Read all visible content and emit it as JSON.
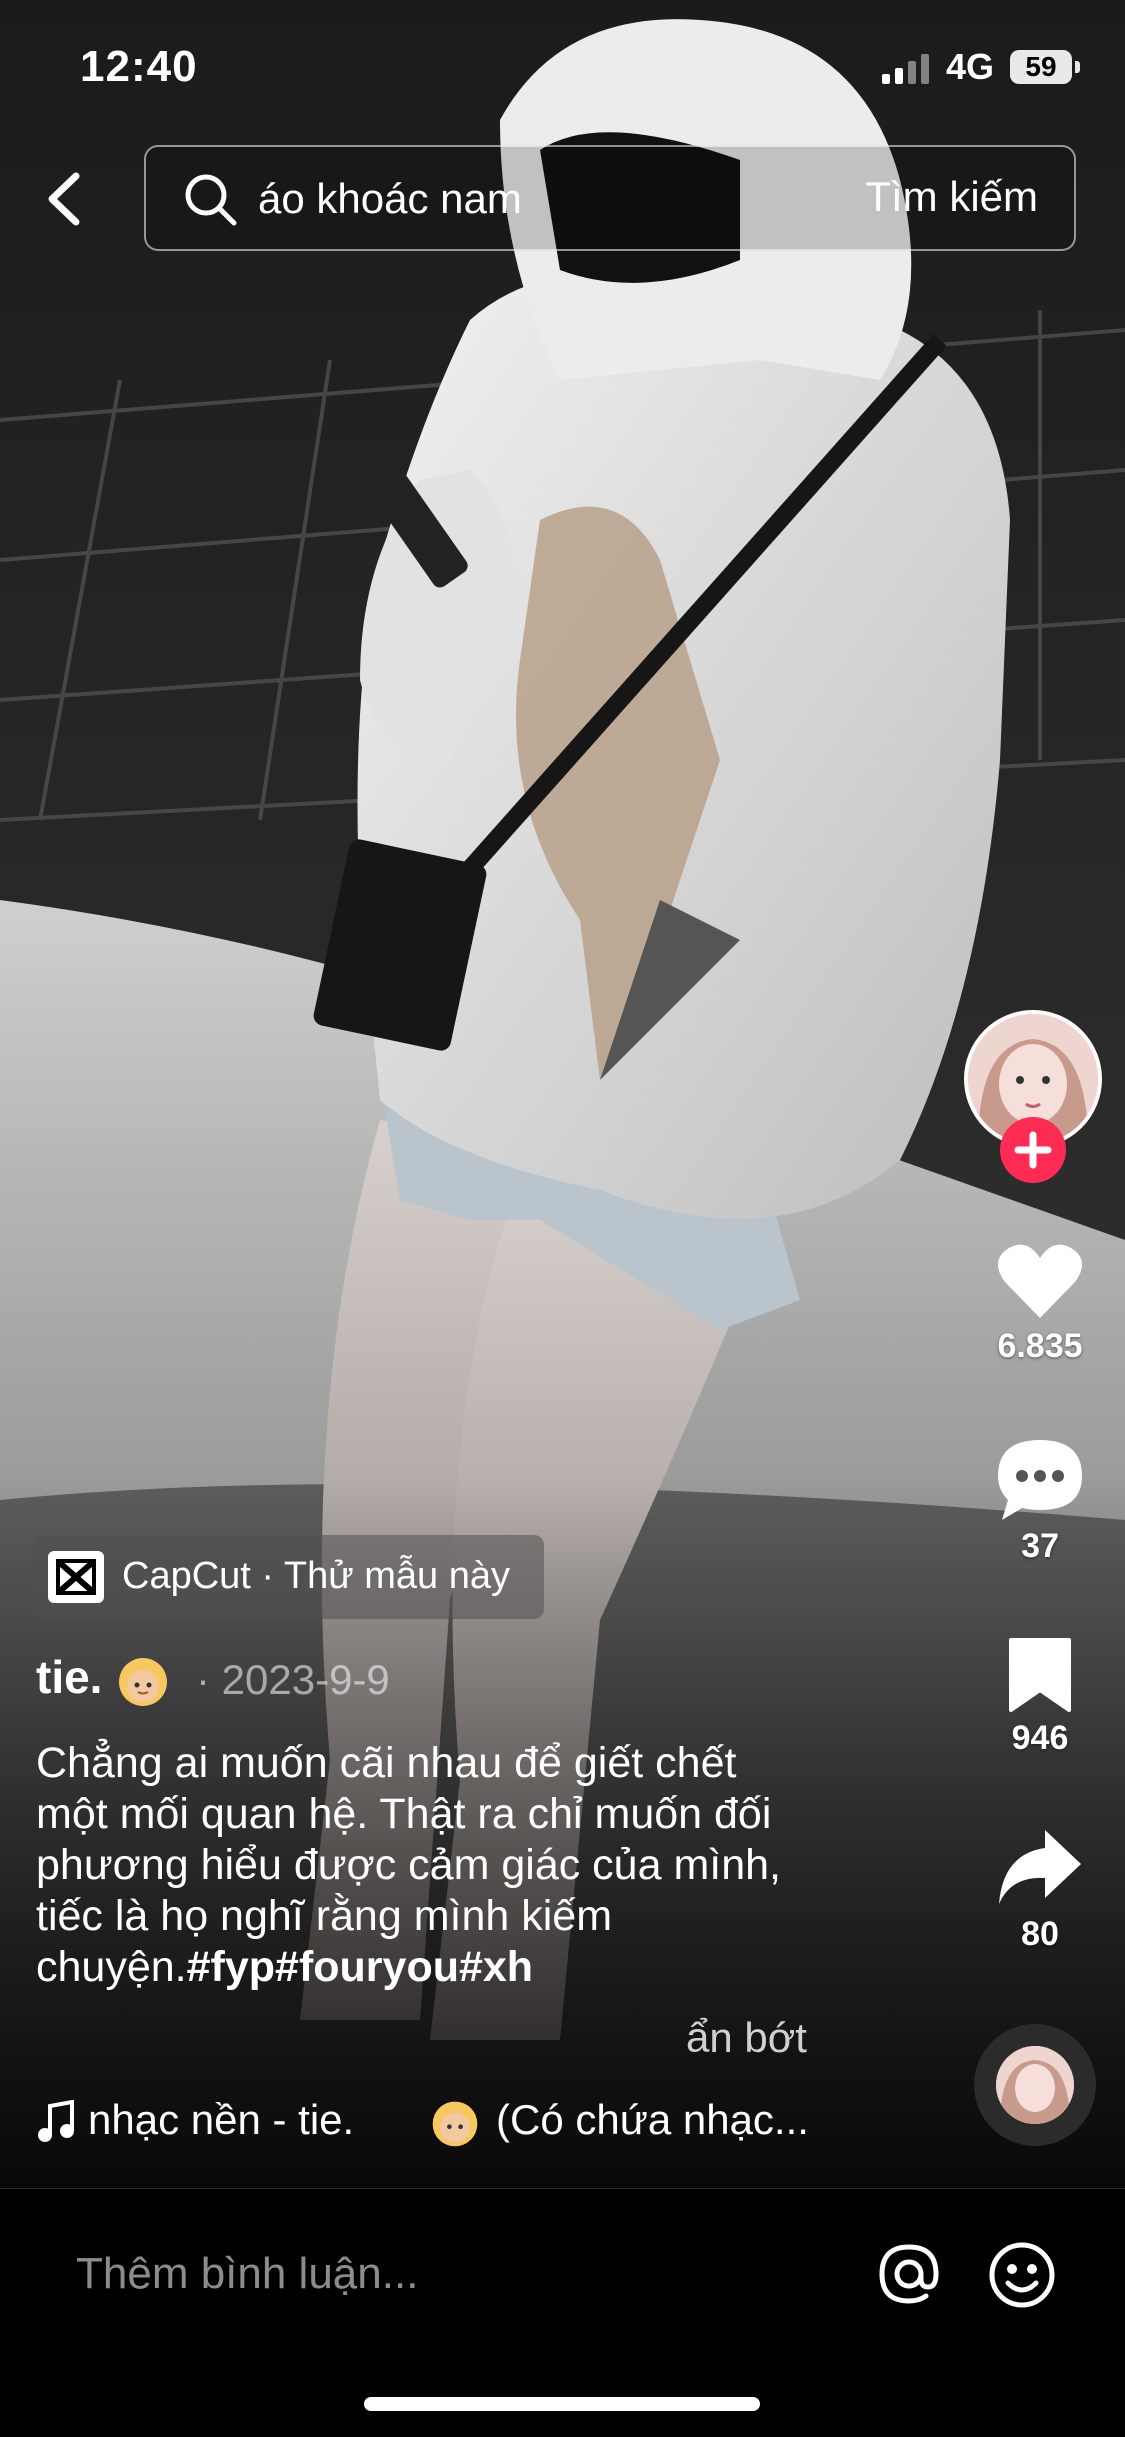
{
  "status_bar": {
    "time": "12:40",
    "network": "4G",
    "battery": "59"
  },
  "search": {
    "query": "áo khoác nam",
    "submit_label": "Tìm kiếm"
  },
  "rail": {
    "likes": "6.835",
    "comments": "37",
    "saves": "946",
    "shares": "80"
  },
  "capcut": {
    "label": "CapCut · Thử mẫu này"
  },
  "post": {
    "author": "tie.",
    "date": "· 2023-9-9",
    "caption_text": "Chẳng ai muốn cãi nhau để giết chết một mối quan hệ. Thật ra chỉ muốn đối phương hiểu được cảm giác của mình, tiếc là họ nghĩ rằng mình kiếm chuyện.",
    "caption_tags": "#fyp#fouryou#xh",
    "show_less": "ẩn bớt"
  },
  "music": {
    "prefix": "nhạc nền - tie.",
    "suffix": "(Có chứa nhạc..."
  },
  "comment_bar": {
    "placeholder": "Thêm bình luận..."
  },
  "colors": {
    "accent": "#fe2c55",
    "background": "#000000"
  },
  "icons": [
    "chevron-left-icon",
    "search-icon",
    "plus-icon",
    "heart-icon",
    "comment-icon",
    "bookmark-icon",
    "share-icon",
    "music-note-icon",
    "at-icon",
    "emoji-icon",
    "capcut-logo-icon"
  ]
}
